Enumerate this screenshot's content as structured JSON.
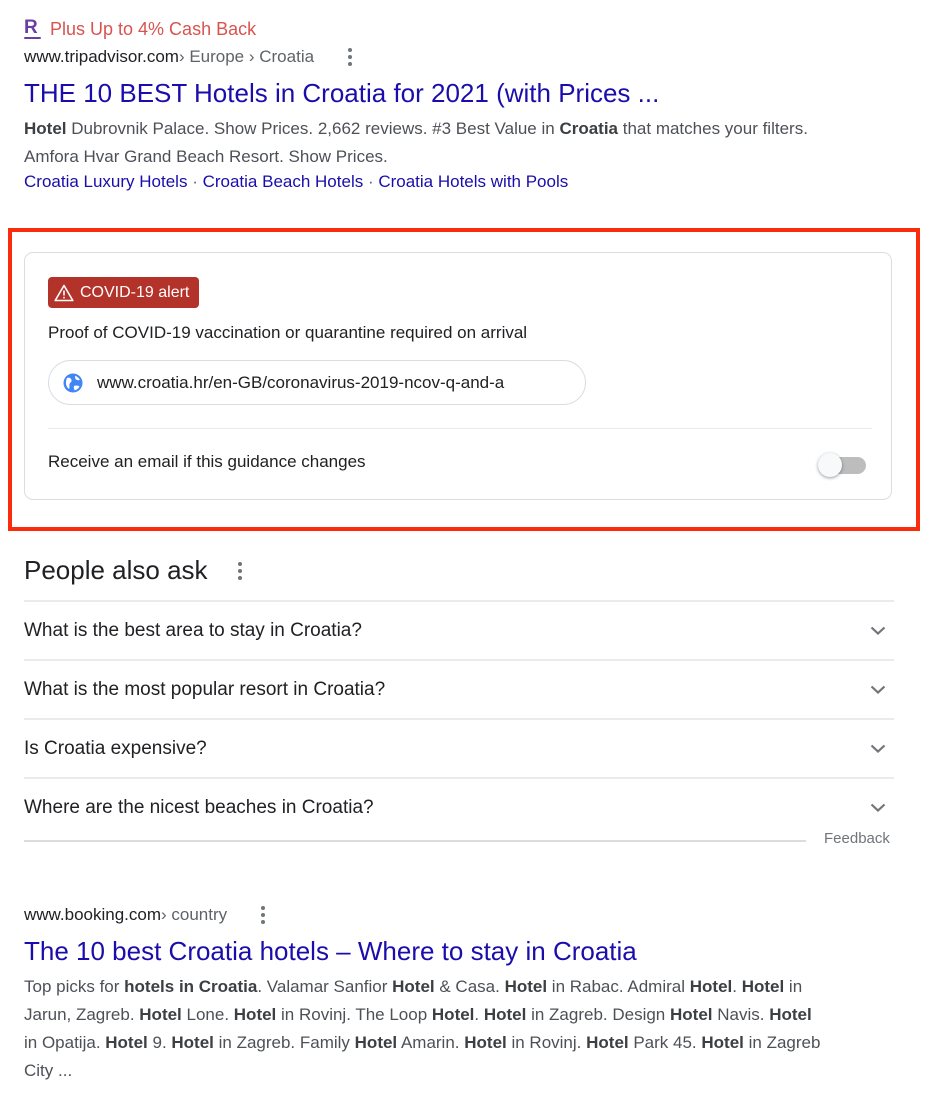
{
  "result1": {
    "ad": {
      "logo_letter": "R",
      "text": "Plus Up to 4% Cash Back",
      "logo_color": "#6b3fa0",
      "text_color": "#d9534f"
    },
    "cite": {
      "domain": "www.tripadvisor.com",
      "crumbs": " › Europe › Croatia"
    },
    "title": "THE 10 BEST Hotels in Croatia for 2021 (with Prices ...",
    "snippet": [
      {
        "t": "Hotel",
        "b": true
      },
      {
        "t": " Dubrovnik Palace. Show Prices. 2,662 reviews. #3 Best Value in ",
        "b": false
      },
      {
        "t": "Croatia",
        "b": true
      },
      {
        "t": " that matches your filters. Amfora Hvar Grand Beach Resort. Show Prices.",
        "b": false
      }
    ],
    "sitelinks": [
      "Croatia Luxury Hotels",
      "Croatia Beach Hotels",
      "Croatia Hotels with Pools"
    ],
    "sitelink_separator": " · "
  },
  "covid_card": {
    "highlight_color": "#fb2c0c",
    "badge": {
      "icon": "warning-triangle-icon",
      "label": "COVID-19 alert",
      "color": "#b3322a"
    },
    "message": "Proof of COVID-19 vaccination or quarantine required on arrival",
    "link": {
      "icon": "globe-icon",
      "url": "www.croatia.hr/en-GB/coronavirus-2019-ncov-q-and-a"
    },
    "email_toggle": {
      "label": "Receive an email if this guidance changes",
      "on": false
    }
  },
  "people_also_ask": {
    "title": "People also ask",
    "questions": [
      "What is the best area to stay in Croatia?",
      "What is the most popular resort in Croatia?",
      "Is Croatia expensive?",
      "Where are the nicest beaches in Croatia?"
    ],
    "feedback_label": "Feedback"
  },
  "result2": {
    "cite": {
      "domain": "www.booking.com",
      "crumbs": " › country"
    },
    "title": "The 10 best Croatia hotels – Where to stay in Croatia",
    "snippet": [
      {
        "t": "Top picks for ",
        "b": false
      },
      {
        "t": "hotels in Croatia",
        "b": true
      },
      {
        "t": ". Valamar Sanfior ",
        "b": false
      },
      {
        "t": "Hotel",
        "b": true
      },
      {
        "t": " & Casa. ",
        "b": false
      },
      {
        "t": "Hotel",
        "b": true
      },
      {
        "t": " in Rabac. Admiral ",
        "b": false
      },
      {
        "t": "Hotel",
        "b": true
      },
      {
        "t": ". ",
        "b": false
      },
      {
        "t": "Hotel",
        "b": true
      },
      {
        "t": " in Jarun, Zagreb. ",
        "b": false
      },
      {
        "t": "Hotel",
        "b": true
      },
      {
        "t": " Lone. ",
        "b": false
      },
      {
        "t": "Hotel",
        "b": true
      },
      {
        "t": " in Rovinj. The Loop ",
        "b": false
      },
      {
        "t": "Hotel",
        "b": true
      },
      {
        "t": ". ",
        "b": false
      },
      {
        "t": "Hotel",
        "b": true
      },
      {
        "t": " in Zagreb. Design ",
        "b": false
      },
      {
        "t": "Hotel",
        "b": true
      },
      {
        "t": " Navis. ",
        "b": false
      },
      {
        "t": "Hotel",
        "b": true
      },
      {
        "t": " in Opatija. ",
        "b": false
      },
      {
        "t": "Hotel",
        "b": true
      },
      {
        "t": " 9. ",
        "b": false
      },
      {
        "t": "Hotel",
        "b": true
      },
      {
        "t": " in Zagreb. Family ",
        "b": false
      },
      {
        "t": "Hotel",
        "b": true
      },
      {
        "t": " Amarin. ",
        "b": false
      },
      {
        "t": "Hotel",
        "b": true
      },
      {
        "t": " in Rovinj. ",
        "b": false
      },
      {
        "t": "Hotel",
        "b": true
      },
      {
        "t": " Park 45. ",
        "b": false
      },
      {
        "t": "Hotel",
        "b": true
      },
      {
        "t": " in Zagreb City ...",
        "b": false
      }
    ]
  }
}
